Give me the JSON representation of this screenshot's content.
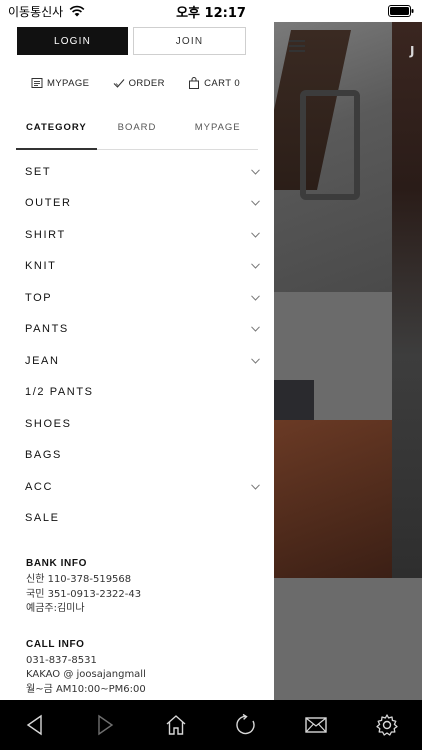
{
  "status_bar": {
    "carrier": "이동통신사",
    "time": "오후 12:17"
  },
  "auth": {
    "login_label": "LOGIN",
    "join_label": "JOIN"
  },
  "quick_links": [
    {
      "label": "MYPAGE",
      "icon": "mypage-icon"
    },
    {
      "label": "ORDER",
      "icon": "order-check-icon"
    },
    {
      "label": "CART 0",
      "icon": "cart-bag-icon"
    }
  ],
  "tabs": [
    {
      "label": "CATEGORY",
      "active": true
    },
    {
      "label": "BOARD",
      "active": false
    },
    {
      "label": "MYPAGE",
      "active": false
    }
  ],
  "categories": [
    {
      "label": "SET",
      "expandable": true
    },
    {
      "label": "OUTER",
      "expandable": true
    },
    {
      "label": "SHIRT",
      "expandable": true
    },
    {
      "label": "KNIT",
      "expandable": true
    },
    {
      "label": "TOP",
      "expandable": true
    },
    {
      "label": "PANTS",
      "expandable": true
    },
    {
      "label": "JEAN",
      "expandable": true
    },
    {
      "label": "1/2 PANTS",
      "expandable": false
    },
    {
      "label": "SHOES",
      "expandable": false
    },
    {
      "label": "BAGS",
      "expandable": false
    },
    {
      "label": "ACC",
      "expandable": true
    },
    {
      "label": "SALE",
      "expandable": false
    }
  ],
  "bank_info": {
    "title": "BANK INFO",
    "lines": [
      "신한 110-378-519568",
      "국민 351-0913-2322-43",
      "예금주:김미나"
    ]
  },
  "call_info": {
    "title": "CALL INFO",
    "lines": [
      "031-837-8531",
      "KAKAO @ joosajangmall",
      "월~금 AM10:00~PM6:00"
    ]
  },
  "background": {
    "right_letter": "J"
  },
  "toolbar": [
    "back-icon",
    "forward-icon",
    "home-icon",
    "refresh-icon",
    "mail-icon",
    "settings-gear-icon"
  ],
  "colors": {
    "login_bg": "#111111",
    "overlay": "#6b6b6b",
    "toolbar_bg": "#000000"
  }
}
